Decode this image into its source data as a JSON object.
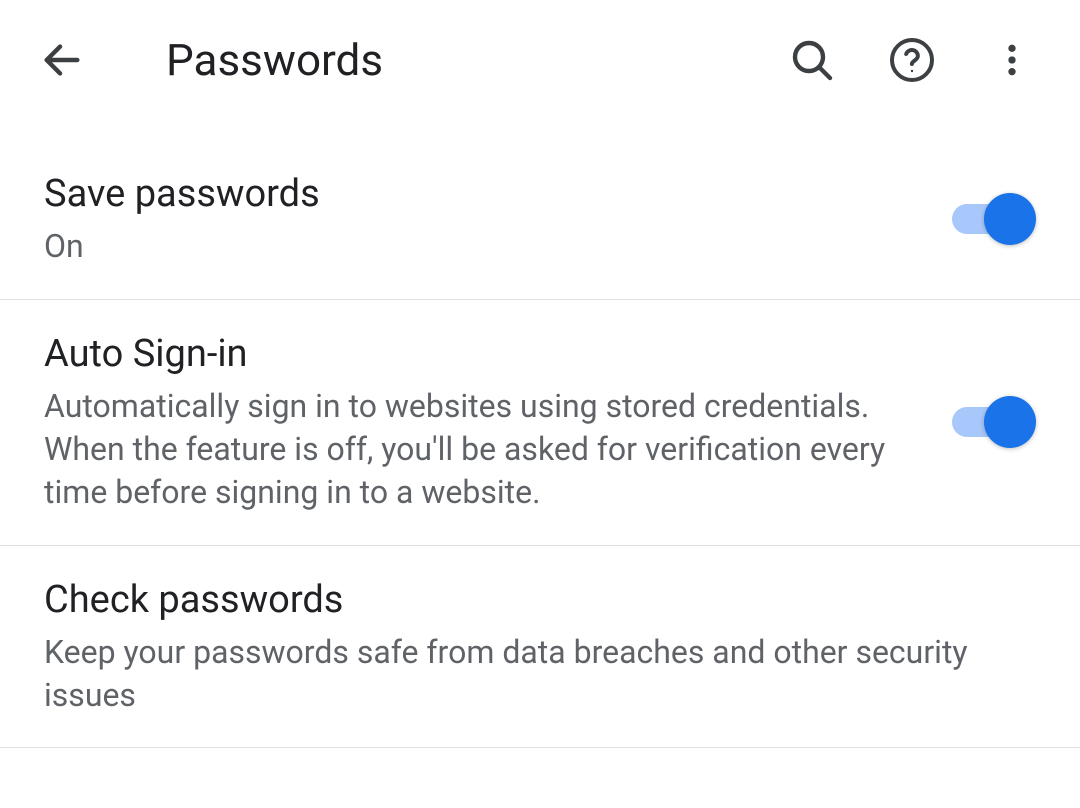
{
  "header": {
    "title": "Passwords"
  },
  "settings": {
    "savePasswords": {
      "title": "Save passwords",
      "subtitle": "On",
      "enabled": true
    },
    "autoSignIn": {
      "title": "Auto Sign-in",
      "subtitle": "Automatically sign in to websites using stored credentials. When the feature is off, you'll be asked for verification every time before signing in to a website.",
      "enabled": true
    },
    "checkPasswords": {
      "title": "Check passwords",
      "subtitle": "Keep your passwords safe from data breaches and other security issues"
    }
  }
}
